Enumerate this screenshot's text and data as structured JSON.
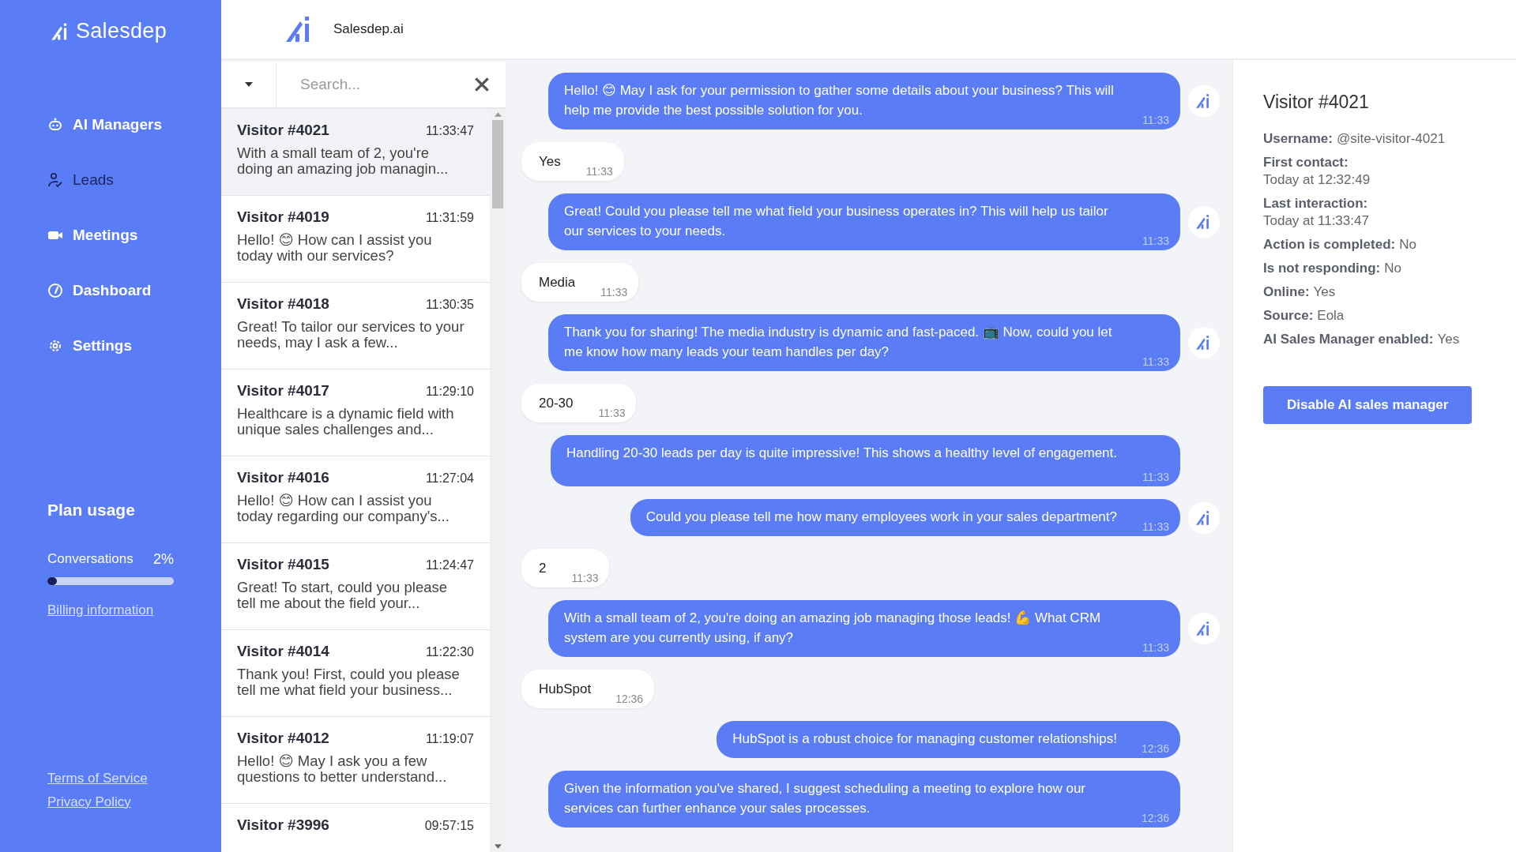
{
  "brand": {
    "name": "Salesdep"
  },
  "nav": [
    {
      "label": "AI Managers",
      "kind": "robot",
      "selected": false
    },
    {
      "label": "Leads",
      "kind": "leads",
      "selected": true
    },
    {
      "label": "Meetings",
      "kind": "camera",
      "selected": false
    },
    {
      "label": "Dashboard",
      "kind": "gauge",
      "selected": false
    },
    {
      "label": "Settings",
      "kind": "gear",
      "selected": false
    }
  ],
  "plan_usage": {
    "title": "Plan usage",
    "label": "Conversations",
    "percent": "2%",
    "level": 0.02,
    "billing_link": "Billing information"
  },
  "footer_links": [
    "Terms of Service",
    "Privacy Policy"
  ],
  "header": {
    "title": "Salesdep.ai"
  },
  "search": {
    "placeholder": "Search..."
  },
  "conversations": [
    {
      "name": "Visitor #4021",
      "time": "11:33:47",
      "preview": "With a small team of 2, you're doing an amazing job managin...",
      "selected": true
    },
    {
      "name": "Visitor #4019",
      "time": "11:31:59",
      "preview": "Hello! 😊 How can I assist you today with our services?",
      "selected": false
    },
    {
      "name": "Visitor #4018",
      "time": "11:30:35",
      "preview": "Great! To tailor our services to your needs, may I ask a few...",
      "selected": false
    },
    {
      "name": "Visitor #4017",
      "time": "11:29:10",
      "preview": "Healthcare is a dynamic field with unique sales challenges and...",
      "selected": false
    },
    {
      "name": "Visitor #4016",
      "time": "11:27:04",
      "preview": "Hello! 😊 How can I assist you today regarding our company's...",
      "selected": false
    },
    {
      "name": "Visitor #4015",
      "time": "11:24:47",
      "preview": "Great! To start, could you please tell me about the field your...",
      "selected": false
    },
    {
      "name": "Visitor #4014",
      "time": "11:22:30",
      "preview": "Thank you! First, could you please tell me what field your business...",
      "selected": false
    },
    {
      "name": "Visitor #4012",
      "time": "11:19:07",
      "preview": "Hello! 😊 May I ask you a few questions to better understand...",
      "selected": false
    },
    {
      "name": "Visitor #3996",
      "time": "09:57:15",
      "selected": false
    }
  ],
  "messages": [
    {
      "kind": "bot",
      "text": "Hello! 😊 May I ask for your permission to gather some details about your business? This will help me provide the best possible solution for you.",
      "time": "11:33",
      "avatar": true
    },
    {
      "kind": "user",
      "text": "Yes",
      "time": "11:33"
    },
    {
      "kind": "bot",
      "text": "Great! Could you please tell me what field your business operates in? This will help us tailor our services to your needs.",
      "time": "11:33",
      "avatar": true
    },
    {
      "kind": "user",
      "text": "Media",
      "time": "11:33"
    },
    {
      "kind": "bot",
      "text": "Thank you for sharing! The media industry is dynamic and fast-paced. 📺 Now, could you let me know how many leads your team handles per day?",
      "time": "11:33",
      "avatar": true
    },
    {
      "kind": "user",
      "text": "20-30",
      "time": "11:33"
    },
    {
      "kind": "bot",
      "text": "Handling 20-30 leads per day is quite impressive! This shows a healthy level of engagement.",
      "time": "11:33",
      "avatar": false,
      "block_time": true
    },
    {
      "kind": "bot",
      "text": "Could you please tell me how many employees work in your sales department?",
      "time": "11:33",
      "avatar": true
    },
    {
      "kind": "user",
      "text": "2",
      "time": "11:33"
    },
    {
      "kind": "bot",
      "text": "With a small team of 2, you're doing an amazing job managing those leads! 💪 What CRM system are you currently using, if any?",
      "time": "11:33",
      "avatar": true
    },
    {
      "kind": "user",
      "text": "HubSpot",
      "time": "12:36"
    },
    {
      "kind": "bot",
      "text": "HubSpot is a robust choice for managing customer relationships!",
      "time": "12:36",
      "avatar": false
    },
    {
      "kind": "bot",
      "text": "Given the information you've shared, I suggest scheduling a meeting to explore how our services can further enhance your sales processes.",
      "time": "12:36",
      "avatar": false
    }
  ],
  "visitor": {
    "title": "Visitor #4021",
    "fields": [
      {
        "label": "Username:",
        "value": "@site-visitor-4021",
        "inline": true
      },
      {
        "label": "First contact:",
        "value": "Today at 12:32:49",
        "inline": false
      },
      {
        "label": "Last interaction:",
        "value": "Today at 11:33:47",
        "inline": false
      },
      {
        "label": "Action is completed:",
        "value": "No",
        "inline": true
      },
      {
        "label": "Is not responding:",
        "value": "No",
        "inline": true
      },
      {
        "label": "Online:",
        "value": "Yes",
        "inline": true
      },
      {
        "label": "Source:",
        "value": "Eola",
        "inline": true
      },
      {
        "label": "AI Sales Manager enabled:",
        "value": "Yes",
        "inline": true
      }
    ],
    "button": "Disable AI sales manager"
  }
}
